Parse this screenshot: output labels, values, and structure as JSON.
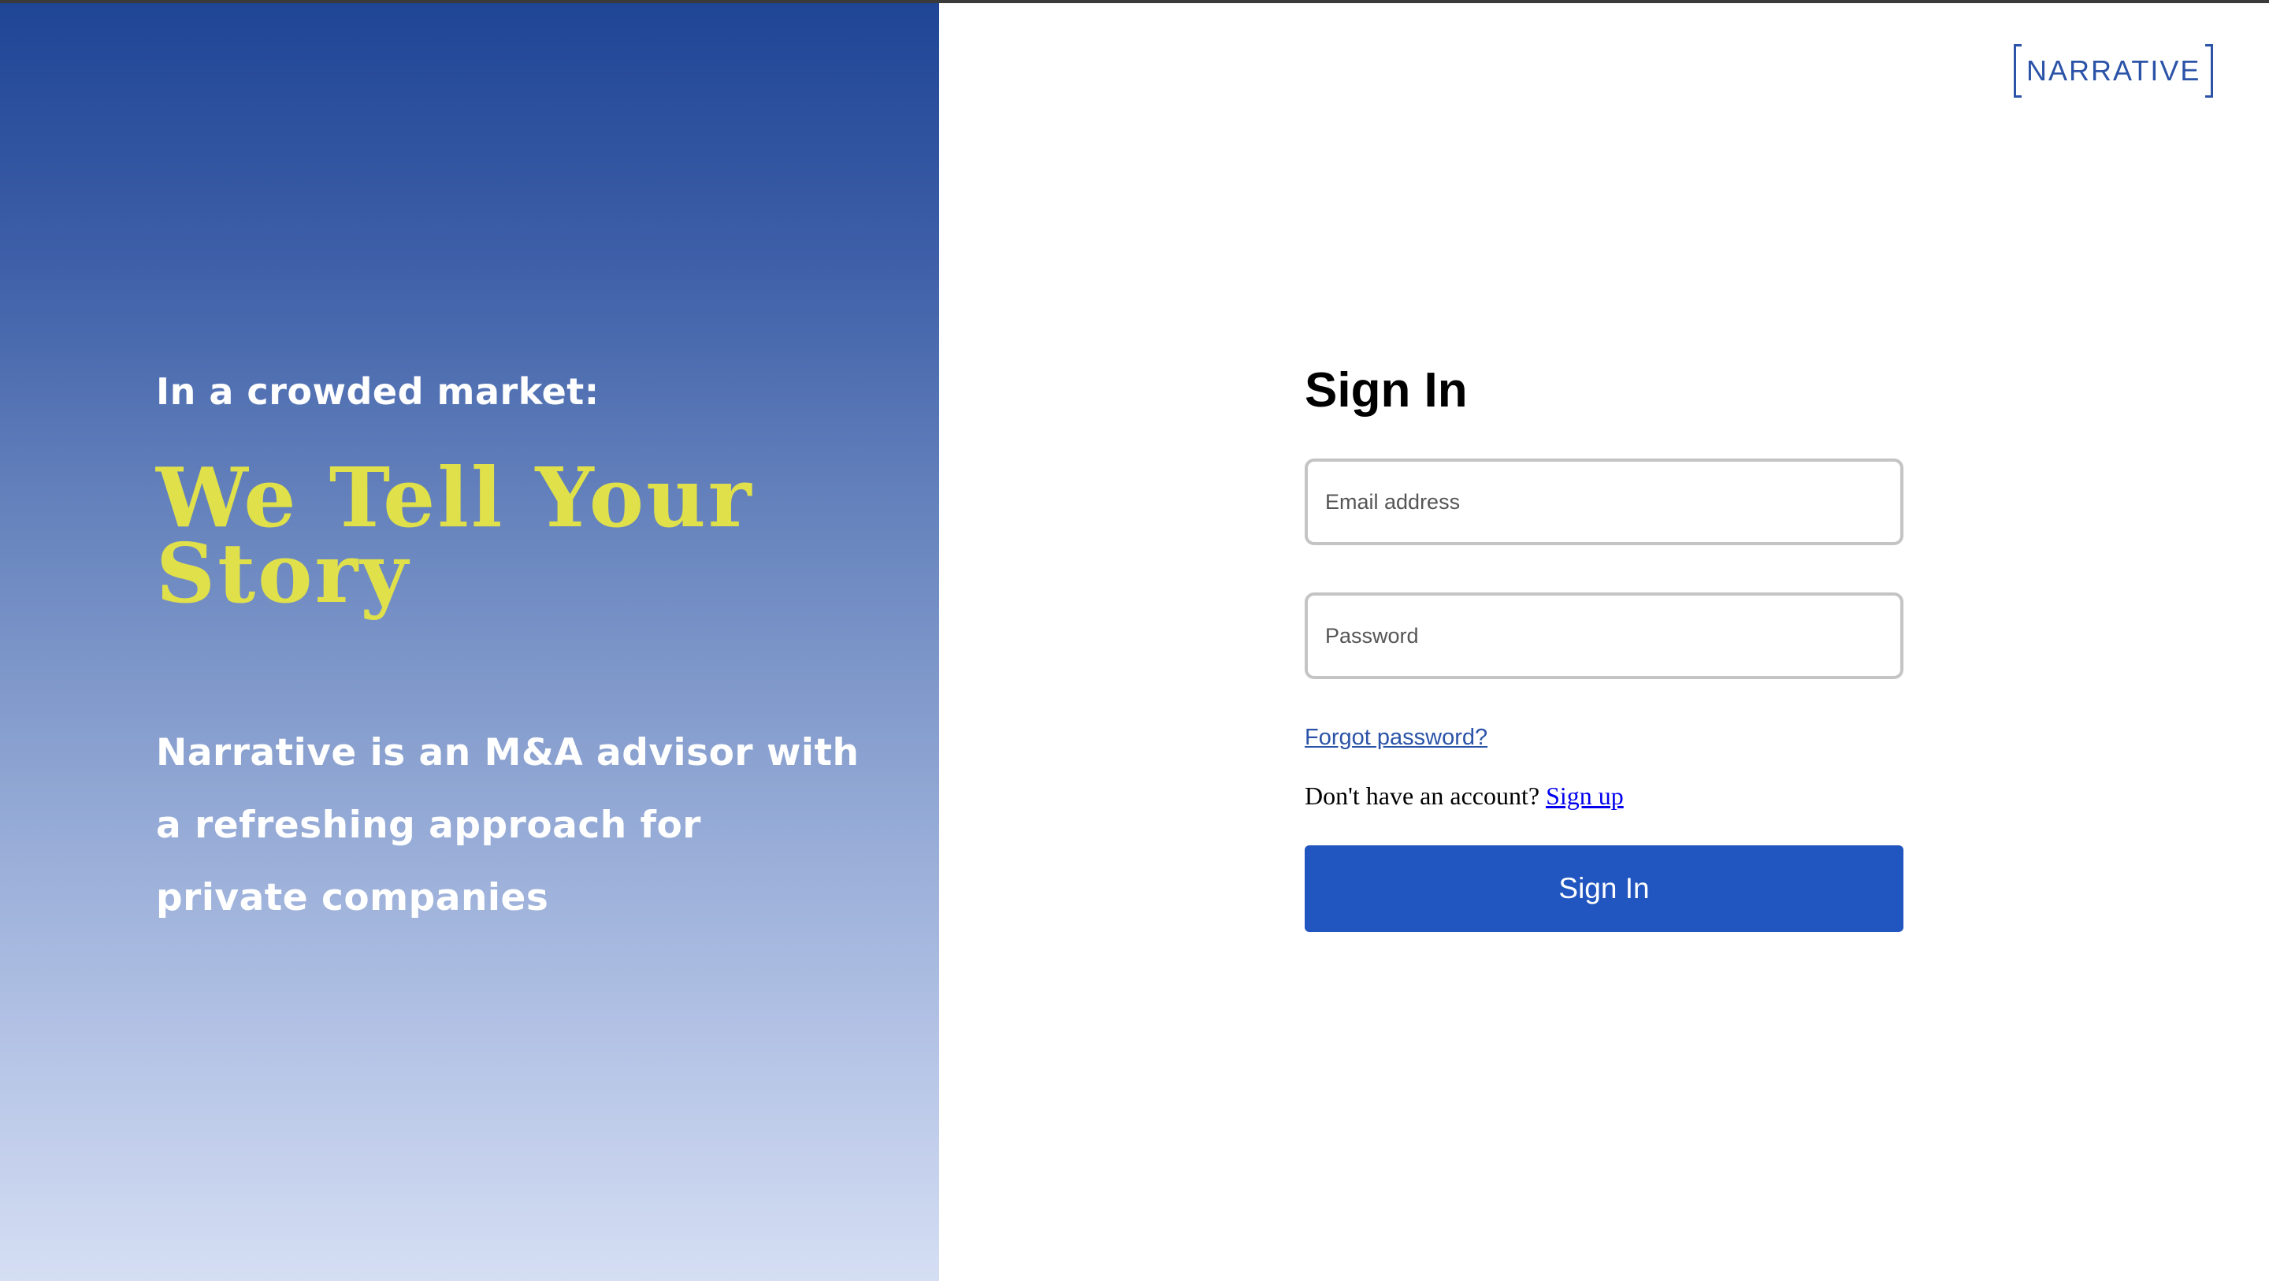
{
  "brand": {
    "logo_text": "NARRATIVE",
    "primary_color": "#2155bf",
    "headline_color": "#dfe04a"
  },
  "hero": {
    "kicker": "In a crowded market:",
    "headline": "We Tell Your Story",
    "body": "Narrative is an M&A advisor with a refreshing approach for private companies"
  },
  "signin": {
    "title": "Sign In",
    "email_placeholder": "Email address",
    "password_placeholder": "Password",
    "forgot_label": "Forgot password?",
    "no_account_text": "Don't have an account?",
    "signup_label": "Sign up",
    "button_label": "Sign In"
  }
}
